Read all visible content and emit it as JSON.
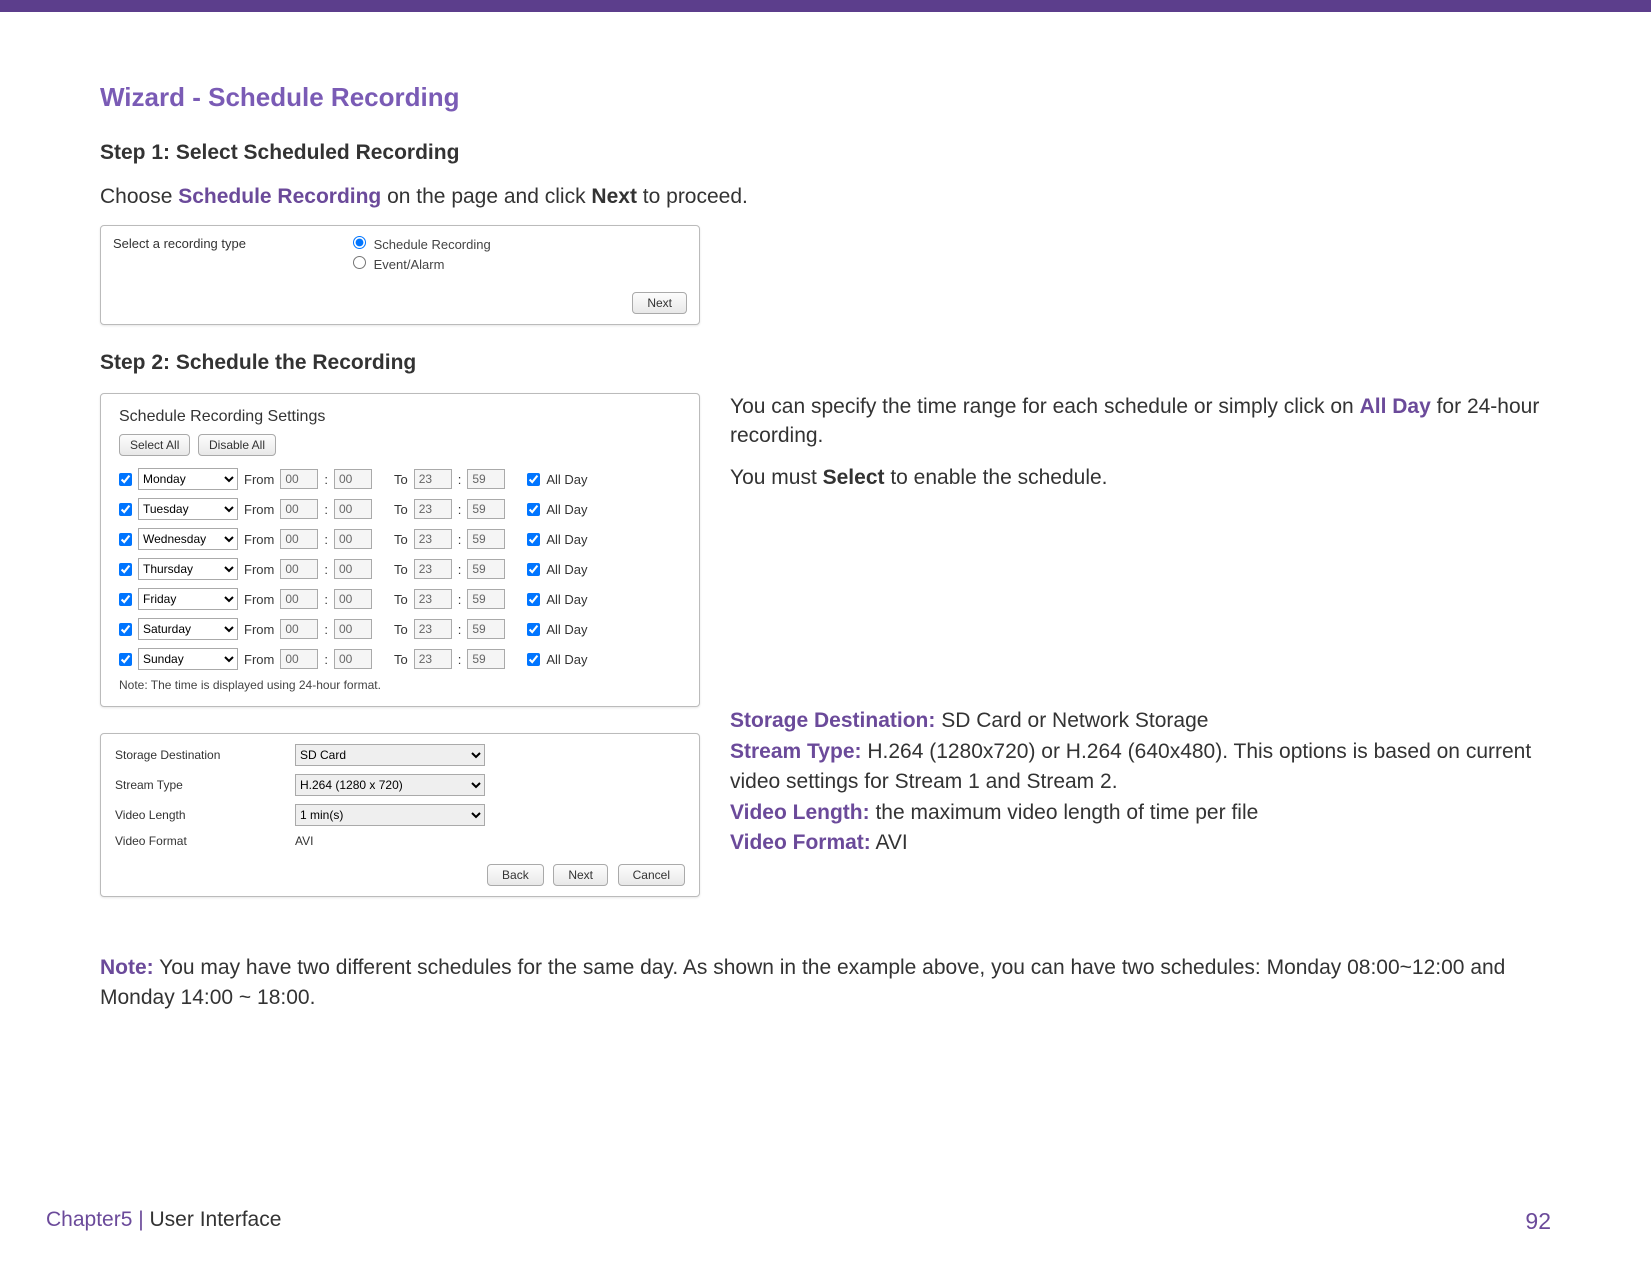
{
  "header": {
    "title": "Wizard - Schedule Recording"
  },
  "step1": {
    "title": "Step 1: Select Scheduled Recording",
    "intro_pre": "Choose ",
    "intro_brand": "Schedule Recording",
    "intro_mid": " on the page and click ",
    "intro_bold": "Next",
    "intro_post": " to proceed.",
    "box": {
      "label": "Select a recording type",
      "opt1": "Schedule Recording",
      "opt2": "Event/Alarm",
      "next": "Next"
    }
  },
  "step2": {
    "title": "Step 2: Schedule the Recording",
    "right_p1_pre": "You can specify the time range for each schedule or simply click on ",
    "right_p1_brand": "All Day",
    "right_p1_post": " for 24-hour recording.",
    "right_p2_pre": "You must ",
    "right_p2_bold": "Select",
    "right_p2_post": " to enable the schedule.",
    "box": {
      "title": "Schedule Recording Settings",
      "select_all": "Select All",
      "disable_all": "Disable All",
      "from": "From",
      "to": "To",
      "colon": ":",
      "allday": "All Day",
      "note": "Note: The time is displayed using 24-hour format.",
      "days": [
        "Monday",
        "Tuesday",
        "Wednesday",
        "Thursday",
        "Friday",
        "Saturday",
        "Sunday"
      ],
      "from_h": "00",
      "from_m": "00",
      "to_h": "23",
      "to_m": "59"
    },
    "box3": {
      "storage_k": "Storage Destination",
      "storage_v": "SD Card",
      "stream_k": "Stream Type",
      "stream_v": "H.264 (1280 x 720)",
      "length_k": "Video Length",
      "length_v": "1 min(s)",
      "format_k": "Video Format",
      "format_v": "AVI",
      "back": "Back",
      "next": "Next",
      "cancel": "Cancel"
    },
    "desc": {
      "storage_l": "Storage Destination:",
      "storage_t": " SD Card or Network Storage",
      "stream_l": "Stream Type:",
      "stream_t": " H.264 (1280x720) or H.264 (640x480). This options is based on current video settings for Stream 1 and Stream 2.",
      "length_l": "Video Length:",
      "length_t": " the maximum video length of time per file",
      "format_l": "Video Format:",
      "format_t": " AVI"
    }
  },
  "note": {
    "label": "Note:",
    "text": " You may have two different schedules for the same day. As shown in the example above, you can have two schedules: Monday 08:00~12:00 and Monday 14:00 ~ 18:00."
  },
  "footer": {
    "chapter": "Chapter5",
    "sep": "  |  ",
    "section": "User Interface",
    "page": "92"
  }
}
